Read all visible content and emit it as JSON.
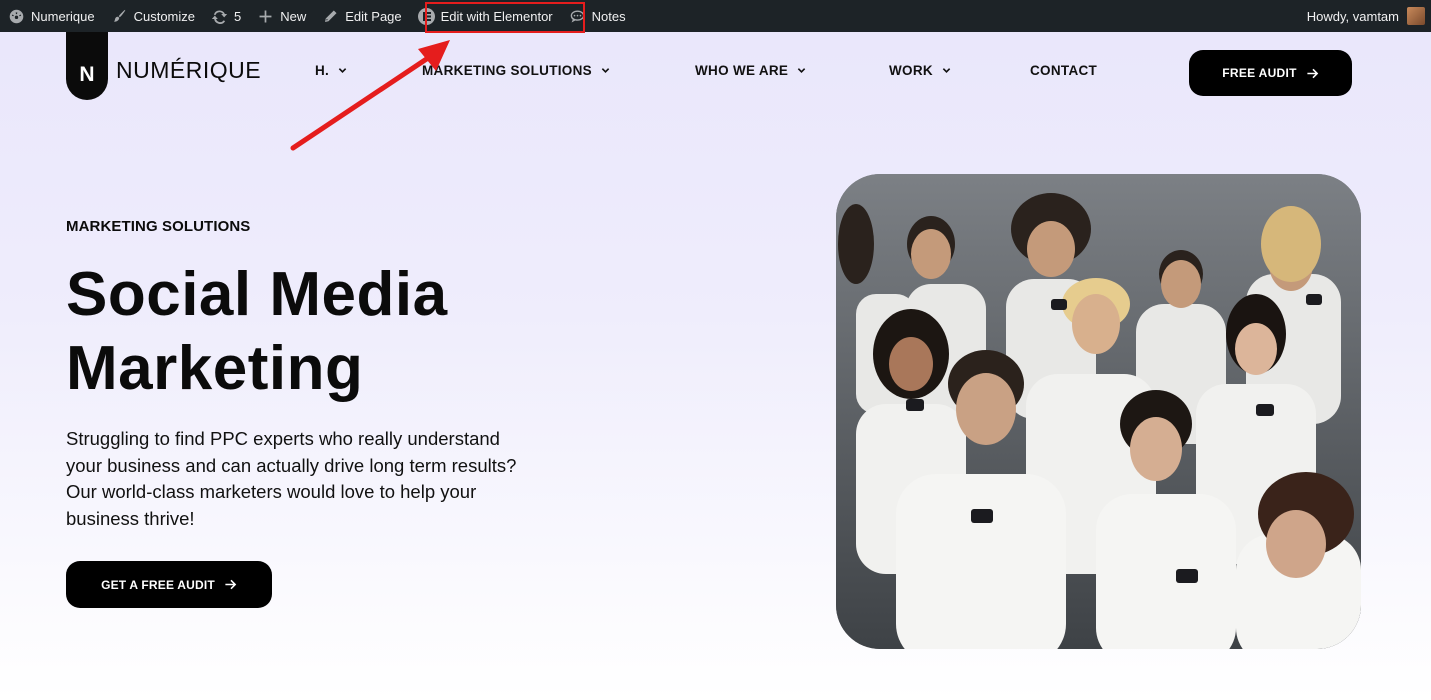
{
  "admin_bar": {
    "site_name": "Numerique",
    "customize": "Customize",
    "updates_count": "5",
    "new": "New",
    "edit_page": "Edit Page",
    "edit_elementor": "Edit with Elementor",
    "notes": "Notes",
    "howdy": "Howdy, vamtam"
  },
  "header": {
    "logo_letter": "N",
    "logo_text": "NUMÉRIQUE",
    "nav": [
      "H.",
      "MARKETING SOLUTIONS",
      "WHO WE ARE",
      "WORK",
      "CONTACT"
    ],
    "cta": "FREE AUDIT"
  },
  "hero": {
    "eyebrow": "MARKETING SOLUTIONS",
    "title_line1": "Social Media",
    "title_line2": "Marketing",
    "description": "Struggling to find PPC experts who really understand your business and can actually drive long term results? Our world-class marketers would love to help your business thrive!",
    "cta": "GET A FREE AUDIT"
  },
  "colors": {
    "admin_bar": "#1d2327",
    "annotation_red": "#e51d1d",
    "button_black": "#000000",
    "bg_lavender": "#e9e6fb"
  },
  "icons": {
    "site": "dashboard-icon",
    "customize": "paintbrush-icon",
    "updates": "refresh-icon",
    "new": "plus-icon",
    "edit": "pencil-icon",
    "elementor": "elementor-icon",
    "notes": "comment-icon",
    "arrow": "arrow-right-icon"
  }
}
